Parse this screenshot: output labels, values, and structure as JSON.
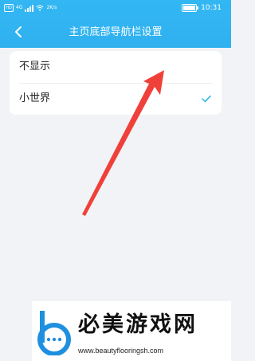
{
  "status_bar": {
    "network_badge": "HD",
    "network_type": "4G",
    "wifi_speed": "2K/s",
    "battery_level": 1.0,
    "time": "10:31"
  },
  "nav": {
    "title": "主页底部导航栏设置",
    "back_icon": "chevron-left-icon"
  },
  "options": [
    {
      "label": "不显示",
      "selected": false
    },
    {
      "label": "小世界",
      "selected": true
    }
  ],
  "colors": {
    "header": "#33b7f3",
    "accent": "#1fb6e8",
    "arrow": "#f0403a",
    "background": "#f2f3f6"
  },
  "watermark": {
    "name": "必美游戏网",
    "url": "www.beautyflooringsh.com"
  }
}
